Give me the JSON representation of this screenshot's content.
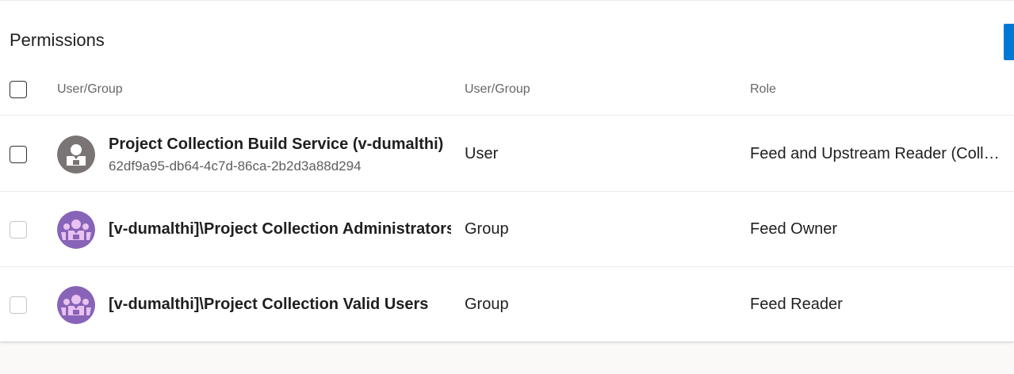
{
  "section": {
    "title": "Permissions"
  },
  "table": {
    "headers": {
      "name": "User/Group",
      "type": "User/Group",
      "role": "Role"
    },
    "rows": [
      {
        "name": "Project Collection Build Service (v-dumalthi)",
        "id": "62df9a95-db64-4c7d-86ca-2b2d3a88d294",
        "type": "User",
        "role": "Feed and Upstream Reader (Collaborator)",
        "avatar_icon": "user-avatar-icon",
        "avatar_color": "#7a7574"
      },
      {
        "name": "[v-dumalthi]\\Project Collection Administrators",
        "id": "",
        "type": "Group",
        "role": "Feed Owner",
        "avatar_icon": "group-avatar-icon",
        "avatar_color": "#8764b8"
      },
      {
        "name": "[v-dumalthi]\\Project Collection Valid Users",
        "id": "",
        "type": "Group",
        "role": "Feed Reader",
        "avatar_icon": "group-avatar-icon",
        "avatar_color": "#8764b8"
      }
    ]
  },
  "colors": {
    "accent": "#0078d4",
    "user_avatar": "#7a7574",
    "group_avatar": "#8764b8",
    "group_avatar_fg": "#e8c2f0"
  }
}
